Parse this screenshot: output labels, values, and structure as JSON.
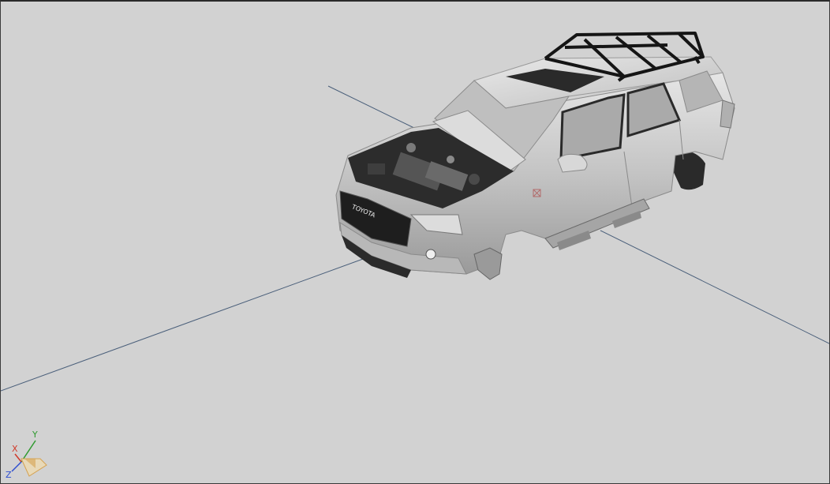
{
  "viewport": {
    "background": "#d2d2d2",
    "grid_line_color": "#4a5f7a"
  },
  "model": {
    "brand_badge": "TOYOTA",
    "body_color": "#c9c9c9",
    "roof_rack_color": "#151515"
  },
  "axis_gizmo": {
    "x_label": "X",
    "y_label": "Y",
    "z_label": "Z",
    "x_color": "#d03a2a",
    "y_color": "#2f9a2f",
    "z_color": "#2f4fd0"
  }
}
